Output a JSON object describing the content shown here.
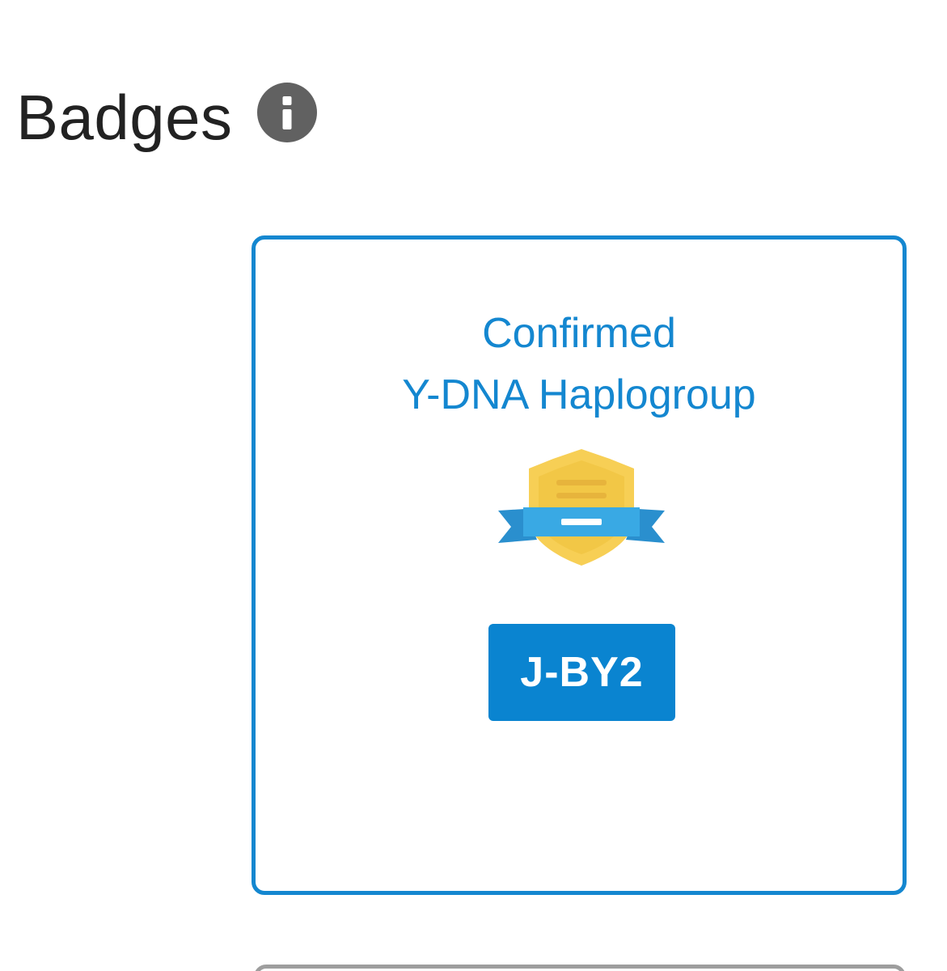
{
  "section": {
    "title": "Badges",
    "info_icon": "info-icon"
  },
  "badge_card": {
    "title_line1": "Confirmed",
    "title_line2": "Y-DNA Haplogroup",
    "emblem_icon": "shield-ribbon-badge-icon",
    "haplogroup": "J-BY2"
  },
  "colors": {
    "accent": "#1487d0",
    "pill": "#0a84d0",
    "title_text": "#222222",
    "info_icon": "#616161",
    "shield": "#f7cf55",
    "ribbon": "#39a9e4"
  }
}
